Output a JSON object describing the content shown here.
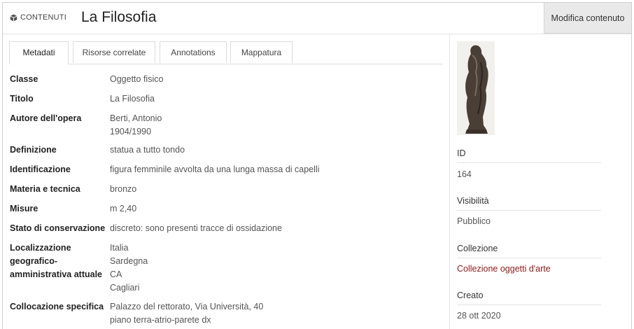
{
  "header": {
    "section_label": "CONTENUTI",
    "title": "La Filosofia",
    "edit_button": "Modifica contenuto"
  },
  "tabs": [
    "Metadati",
    "Risorse correlate",
    "Annotations",
    "Mappatura"
  ],
  "fields": [
    {
      "label": [
        "Classe"
      ],
      "values": [
        "Oggetto fisico"
      ]
    },
    {
      "label": [
        "Titolo"
      ],
      "values": [
        "La Filosofia"
      ]
    },
    {
      "label": [
        "Autore dell'opera"
      ],
      "values": [
        "Berti, Antonio",
        "1904/1990"
      ]
    },
    {
      "label": [
        "Definizione"
      ],
      "values": [
        "statua a tutto tondo"
      ]
    },
    {
      "label": [
        "Identificazione"
      ],
      "values": [
        "figura femminile avvolta da una lunga massa di capelli"
      ]
    },
    {
      "label": [
        "Materia e tecnica"
      ],
      "values": [
        "bronzo"
      ]
    },
    {
      "label": [
        "Misure"
      ],
      "values": [
        "m 2,40"
      ]
    },
    {
      "label": [
        "Stato di conservazione"
      ],
      "values": [
        "discreto: sono presenti tracce di ossidazione"
      ]
    },
    {
      "label": [
        "Localizzazione",
        "geografico-",
        "amministrativa attuale"
      ],
      "values": [
        "Italia",
        "Sardegna",
        "CA",
        "Cagliari"
      ]
    },
    {
      "label": [
        "Collocazione specifica"
      ],
      "values": [
        "Palazzo del rettorato, Via Università, 40",
        "piano terra-atrio-parete dx"
      ]
    }
  ],
  "sidebar": {
    "id_label": "ID",
    "id_value": "164",
    "visibility_label": "Visibilità",
    "visibility_value": "Pubblico",
    "collection_label": "Collezione",
    "collection_value": "Collezione oggetti d'arte",
    "created_label": "Creato",
    "created_value": "28 ott 2020"
  },
  "colors": {
    "link": "#8b1a1a",
    "button_bg": "#e9e9e9"
  }
}
